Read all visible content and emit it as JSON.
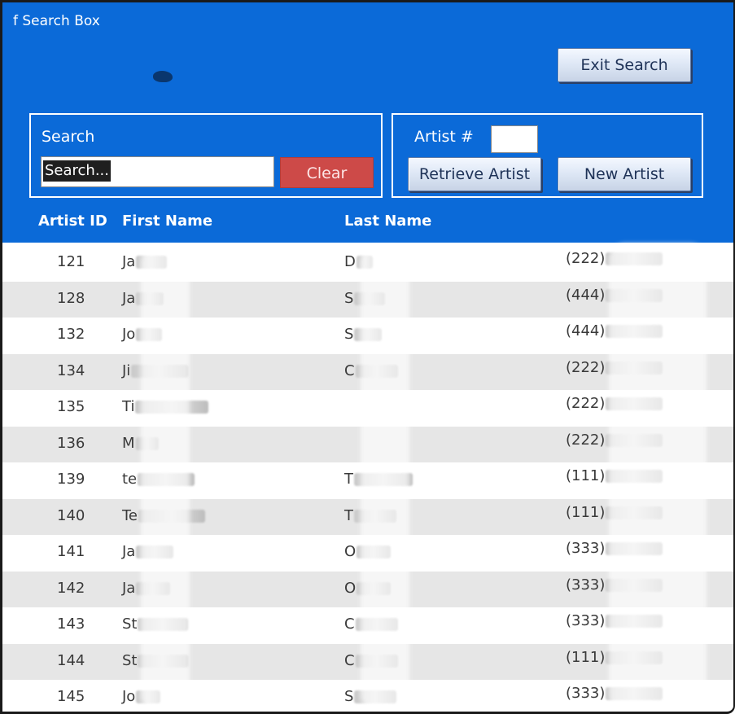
{
  "window": {
    "title": "f Search Box"
  },
  "buttons": {
    "exit_search": "Exit Search",
    "clear": "Clear",
    "retrieve_artist": "Retrieve Artist",
    "new_artist": "New Artist"
  },
  "search": {
    "label": "Search",
    "value": "Search..."
  },
  "artist_lookup": {
    "label": "Artist #",
    "value": ""
  },
  "table": {
    "headers": [
      "Artist ID",
      "First Name",
      "Last Name"
    ],
    "rows": [
      {
        "id": "121",
        "first": "Ja",
        "last": "D",
        "phone": "(222)"
      },
      {
        "id": "128",
        "first": "Ja",
        "last": "S",
        "phone": "(444)"
      },
      {
        "id": "132",
        "first": "Jo",
        "last": "S",
        "phone": "(444)"
      },
      {
        "id": "134",
        "first": "Ji",
        "last": "C",
        "phone": "(222)"
      },
      {
        "id": "135",
        "first": "Ti",
        "last": "",
        "phone": "(222)"
      },
      {
        "id": "136",
        "first": "M",
        "last": "",
        "phone": "(222)"
      },
      {
        "id": "139",
        "first": "te",
        "last": "T",
        "phone": "(111)"
      },
      {
        "id": "140",
        "first": "Te",
        "last": "T",
        "phone": "(111)"
      },
      {
        "id": "141",
        "first": "Ja",
        "last": "O",
        "phone": "(333)"
      },
      {
        "id": "142",
        "first": "Ja",
        "last": "O",
        "phone": "(333)"
      },
      {
        "id": "143",
        "first": "St",
        "last": "C",
        "phone": "(333)"
      },
      {
        "id": "144",
        "first": "St",
        "last": "C",
        "phone": "(111)"
      },
      {
        "id": "145",
        "first": "Jo",
        "last": "S",
        "phone": "(333)"
      }
    ]
  },
  "colors": {
    "header_blue": "#0b6ad8",
    "clear_red": "#cd4a48",
    "row_alt": "#e6e6e6"
  }
}
